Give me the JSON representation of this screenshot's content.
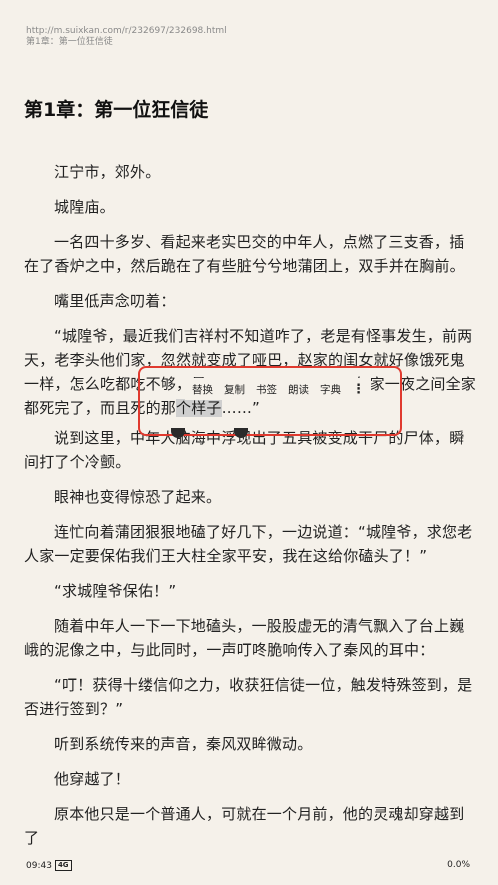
{
  "header": {
    "url": "http://m.suixkan.com/r/232697/232698.html",
    "chapter_small": "第1章：第一位狂信徒"
  },
  "chapter_title": "第1章：第一位狂信徒",
  "paragraphs": {
    "p1": "江宁市，郊外。",
    "p2": "城隍庙。",
    "p3": "一名四十多岁、看起来老实巴交的中年人，点燃了三支香，插在了香炉之中，然后跪在了有些脏兮兮地蒲团上，双手并在胸前。",
    "p4": "嘴里低声念叨着：",
    "p5a": "“城隍爷，最近我们吉祥村不知道咋了，老是有怪事发生，前两天，老李头他们家，忽然就变成了哑巴，赵家的闺女就好像饿死鬼一样，怎么吃都吃不够，最",
    "p5b": "句家一夜之间全家都死完了，而且死的那",
    "p5sel": "个样子",
    "p5c": "……”",
    "p6": "说到这里，中年人脑海中浮现出了五具被变成干尸的尸体，瞬间打了个冷颤。",
    "p7": "眼神也变得惊恐了起来。",
    "p8": "连忙向着蒲团狠狠地磕了好几下，一边说道：“城隍爷，求您老人家一定要保佑我们王大柱全家平安，我在这给你磕头了！”",
    "p9": "“求城隍爷保佑！”",
    "p10": "随着中年人一下一下地磕头，一股股虚无的清气飘入了台上巍峨的泥像之中，与此同时，一声叮咚脆响传入了秦风的耳中：",
    "p11": "“叮！获得十缕信仰之力，收获狂信徒一位，触发特殊签到，是否进行签到？”",
    "p12": "听到系统传来的声音，秦风双眸微动。",
    "p13": "他穿越了！",
    "p14": "原本他只是一个普通人，可就在一个月前，他的灵魂却穿越到了"
  },
  "popup": {
    "replace": "替换",
    "copy": "复制",
    "bookmark": "书签",
    "read_aloud": "朗读",
    "dictionary": "字典",
    "more": "⋮"
  },
  "status": {
    "time": "09:43",
    "network": "4G",
    "progress": "0.0%"
  },
  "colors": {
    "background": "#f5f1ea",
    "highlight_box": "#e03a2f"
  }
}
